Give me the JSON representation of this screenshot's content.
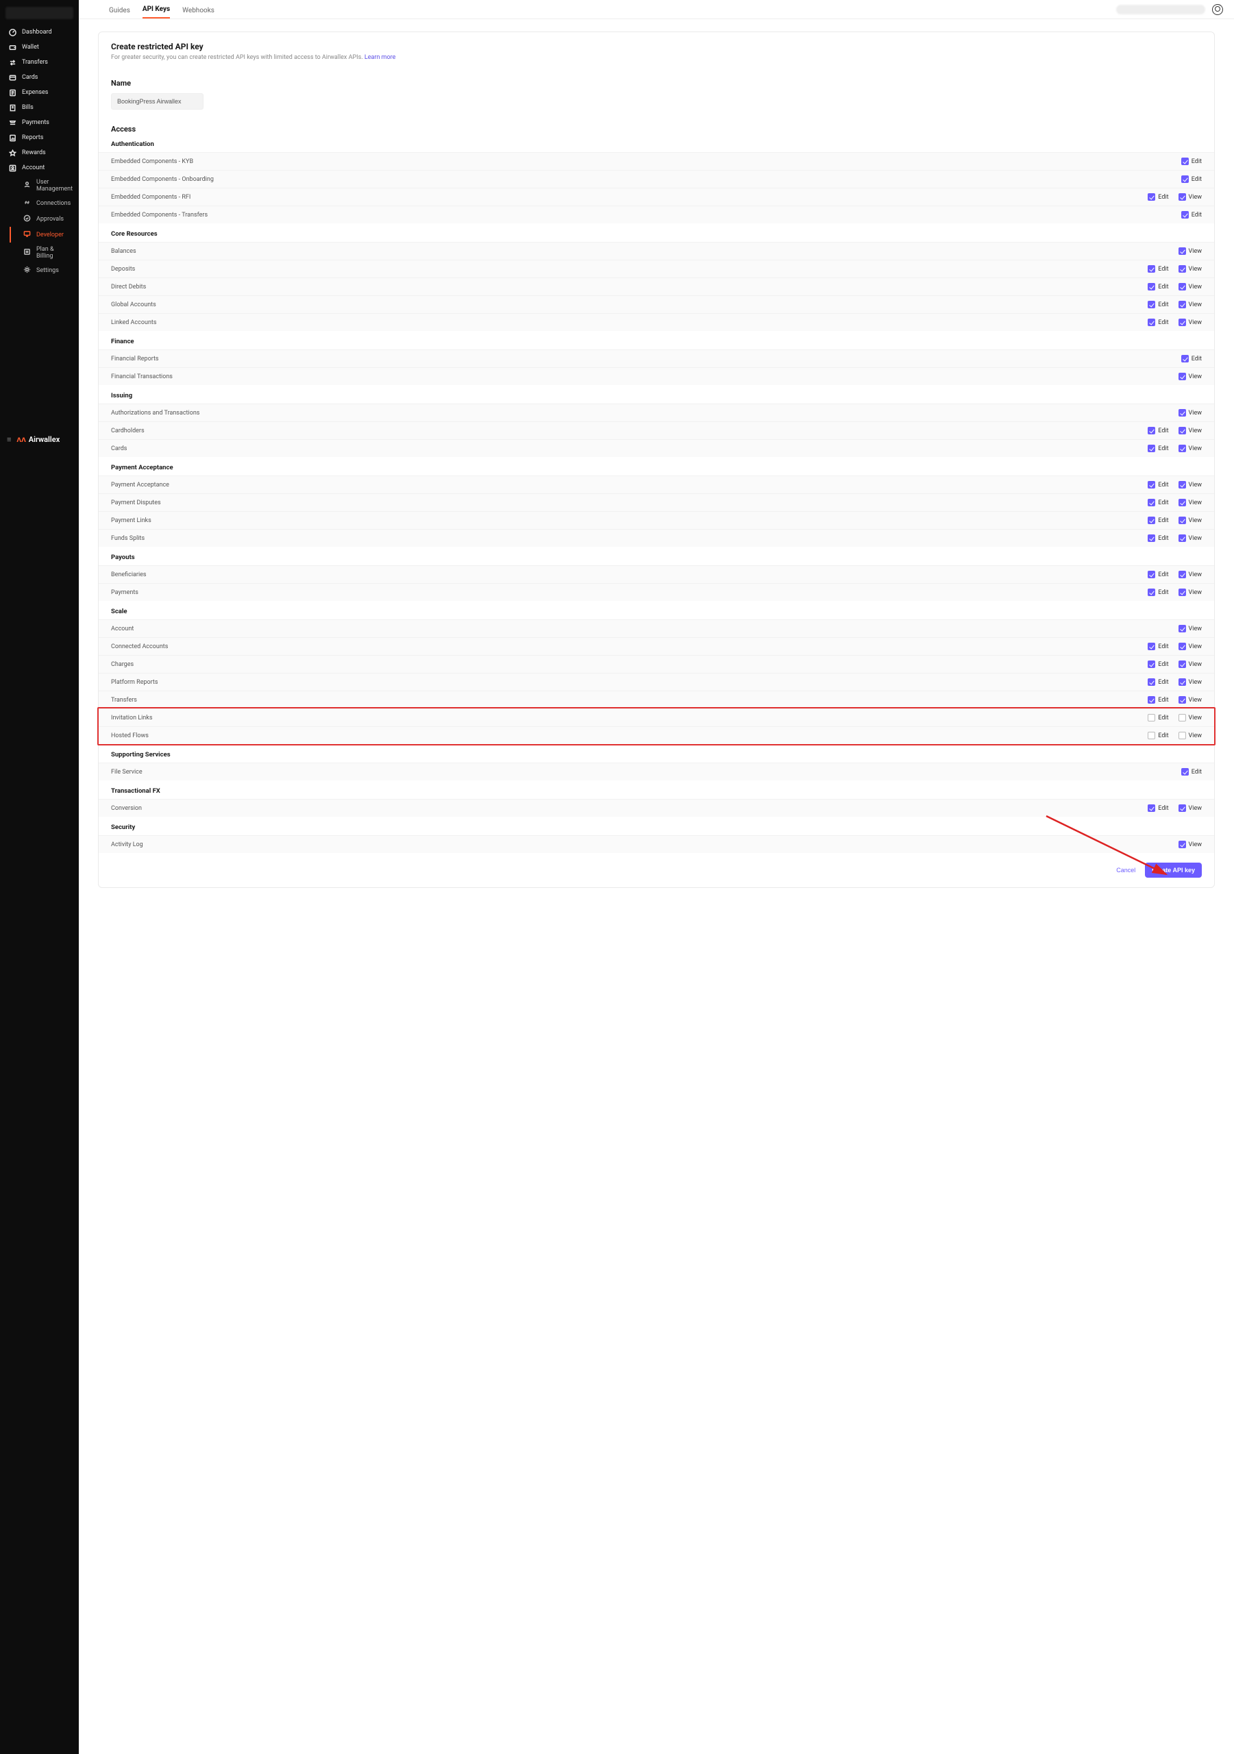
{
  "sidebar": {
    "items": [
      {
        "label": "Dashboard",
        "icon": "gauge-icon"
      },
      {
        "label": "Wallet",
        "icon": "wallet-icon"
      },
      {
        "label": "Transfers",
        "icon": "transfers-icon"
      },
      {
        "label": "Cards",
        "icon": "cards-icon"
      },
      {
        "label": "Expenses",
        "icon": "expenses-icon"
      },
      {
        "label": "Bills",
        "icon": "bills-icon"
      },
      {
        "label": "Payments",
        "icon": "payments-icon"
      },
      {
        "label": "Reports",
        "icon": "reports-icon"
      },
      {
        "label": "Rewards",
        "icon": "rewards-icon"
      },
      {
        "label": "Account",
        "icon": "account-icon"
      }
    ],
    "sub": [
      {
        "label": "User Management",
        "icon": "user-icon"
      },
      {
        "label": "Connections",
        "icon": "link-icon"
      },
      {
        "label": "Approvals",
        "icon": "check-icon"
      },
      {
        "label": "Developer",
        "icon": "monitor-icon",
        "active": true
      },
      {
        "label": "Plan & Billing",
        "icon": "plan-icon"
      },
      {
        "label": "Settings",
        "icon": "gear-icon"
      }
    ],
    "brand": "Airwallex"
  },
  "topbar": {
    "tabs": [
      {
        "label": "Guides"
      },
      {
        "label": "API Keys",
        "active": true
      },
      {
        "label": "Webhooks"
      }
    ]
  },
  "card": {
    "title": "Create restricted API key",
    "desc": "For greater security, you can create restricted API keys with limited access to Airwallex APIs.",
    "learn": "Learn more",
    "name_section": "Name",
    "name_value": "BookingPress Airwallex",
    "access_section": "Access"
  },
  "labels": {
    "edit": "Edit",
    "view": "View"
  },
  "groups": [
    {
      "title": "Authentication",
      "rows": [
        {
          "name": "Embedded Components - KYB",
          "edit": true
        },
        {
          "name": "Embedded Components - Onboarding",
          "edit": true
        },
        {
          "name": "Embedded Components - RFI",
          "edit": true,
          "view": true
        },
        {
          "name": "Embedded Components - Transfers",
          "edit": true
        }
      ]
    },
    {
      "title": "Core Resources",
      "rows": [
        {
          "name": "Balances",
          "view": true
        },
        {
          "name": "Deposits",
          "edit": true,
          "view": true
        },
        {
          "name": "Direct Debits",
          "edit": true,
          "view": true
        },
        {
          "name": "Global Accounts",
          "edit": true,
          "view": true
        },
        {
          "name": "Linked Accounts",
          "edit": true,
          "view": true
        }
      ]
    },
    {
      "title": "Finance",
      "rows": [
        {
          "name": "Financial Reports",
          "edit": true
        },
        {
          "name": "Financial Transactions",
          "view": true
        }
      ]
    },
    {
      "title": "Issuing",
      "rows": [
        {
          "name": "Authorizations and Transactions",
          "view": true
        },
        {
          "name": "Cardholders",
          "edit": true,
          "view": true
        },
        {
          "name": "Cards",
          "edit": true,
          "view": true
        }
      ]
    },
    {
      "title": "Payment Acceptance",
      "rows": [
        {
          "name": "Payment Acceptance",
          "edit": true,
          "view": true
        },
        {
          "name": "Payment Disputes",
          "edit": true,
          "view": true
        },
        {
          "name": "Payment Links",
          "edit": true,
          "view": true
        },
        {
          "name": "Funds Splits",
          "edit": true,
          "view": true
        }
      ]
    },
    {
      "title": "Payouts",
      "rows": [
        {
          "name": "Beneficiaries",
          "edit": true,
          "view": true
        },
        {
          "name": "Payments",
          "edit": true,
          "view": true
        }
      ]
    },
    {
      "title": "Scale",
      "rows": [
        {
          "name": "Account",
          "view": true
        },
        {
          "name": "Connected Accounts",
          "edit": true,
          "view": true
        },
        {
          "name": "Charges",
          "edit": true,
          "view": true
        },
        {
          "name": "Platform Reports",
          "edit": true,
          "view": true
        },
        {
          "name": "Transfers",
          "edit": true,
          "view": true
        },
        {
          "name": "Invitation Links",
          "edit": false,
          "view": false,
          "hl": true
        },
        {
          "name": "Hosted Flows",
          "edit": false,
          "view": false,
          "hl": true
        }
      ]
    },
    {
      "title": "Supporting Services",
      "rows": [
        {
          "name": "File Service",
          "edit": true
        }
      ]
    },
    {
      "title": "Transactional FX",
      "rows": [
        {
          "name": "Conversion",
          "edit": true,
          "view": true
        }
      ]
    },
    {
      "title": "Security",
      "rows": [
        {
          "name": "Activity Log",
          "view": true
        }
      ]
    }
  ],
  "footer": {
    "cancel": "Cancel",
    "create": "Create API key"
  }
}
